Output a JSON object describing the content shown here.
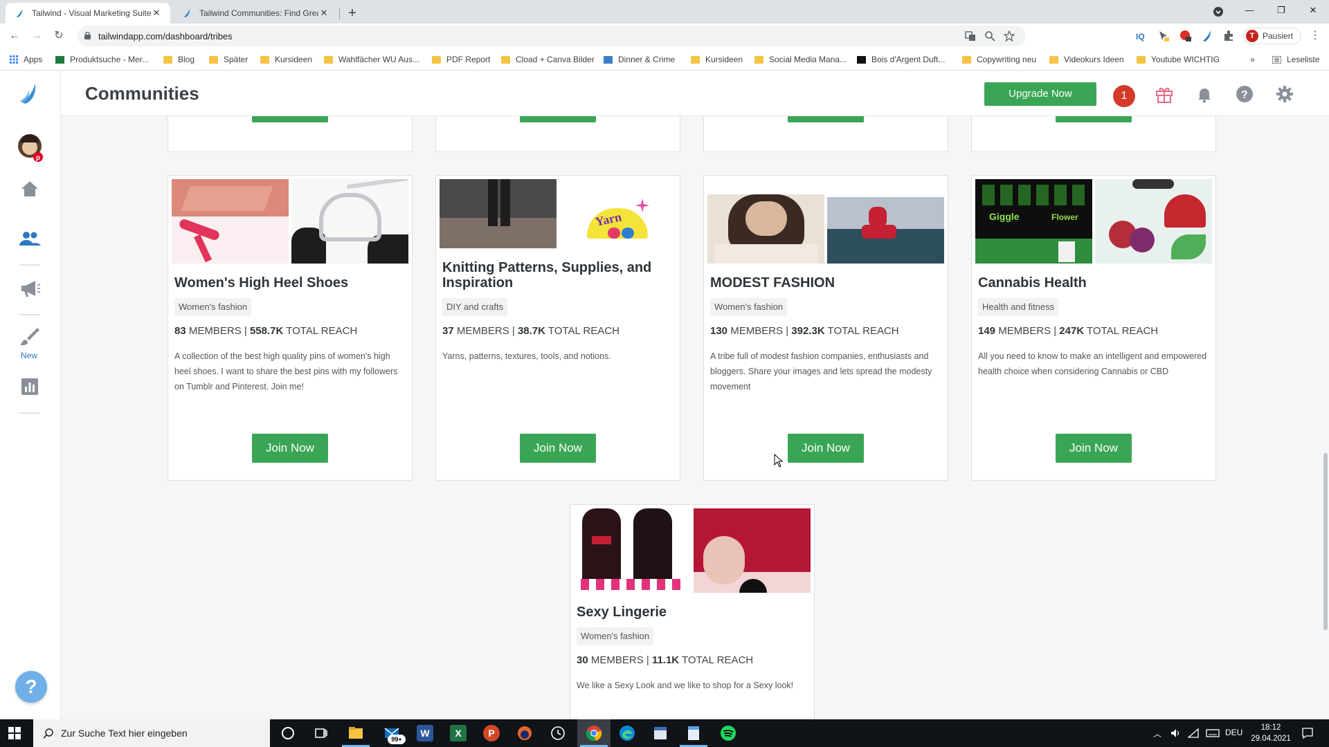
{
  "browser": {
    "tabs": [
      {
        "title": "Tailwind - Visual Marketing Suite"
      },
      {
        "title": "Tailwind Communities: Find Great"
      }
    ],
    "url": "tailwindapp.com/dashboard/tribes",
    "profile_initial": "T",
    "profile_label": "Pausiert",
    "bookmarks": [
      "Apps",
      "Produktsuche - Mer...",
      "Blog",
      "Später",
      "Kursideen",
      "Wahlfächer WU Aus...",
      "PDF Report",
      "Cload + Canva Bilder",
      "Dinner & Crime",
      "Kursideen",
      "Social Media Mana...",
      "Bois d'Argent Duft...",
      "Copywriting neu",
      "Videokurs Ideen",
      "Youtube WICHTIG"
    ],
    "reading_list": "Leseliste"
  },
  "app": {
    "page_title": "Communities",
    "upgrade_label": "Upgrade Now",
    "notification_count": "1",
    "sidebar_new_label": "New",
    "help_label": "?",
    "join_label": "Join Now"
  },
  "communities": [
    {
      "title": "Women's High Heel Shoes",
      "category": "Women's fashion",
      "members": "83",
      "members_label": " MEMBERS | ",
      "reach": "558.7K",
      "reach_label": " TOTAL REACH",
      "description": "A collection of the best high quality pins of women's high heel shoes. I want to share the best pins with my followers on Tumblr and Pinterest. Join me!"
    },
    {
      "title": "Knitting Patterns, Supplies, and Inspiration",
      "category": "DIY and crafts",
      "members": "37",
      "members_label": " MEMBERS | ",
      "reach": "38.7K",
      "reach_label": " TOTAL REACH",
      "description": "Yarns, patterns, textures, tools, and notions."
    },
    {
      "title": "MODEST FASHION",
      "category": "Women's fashion",
      "members": "130",
      "members_label": " MEMBERS | ",
      "reach": "392.3K",
      "reach_label": " TOTAL REACH",
      "description": "A tribe full of modest fashion companies, enthusiasts and bloggers. Share your images and lets spread the modesty movement"
    },
    {
      "title": "Cannabis Health",
      "category": "Health and fitness",
      "members": "149",
      "members_label": " MEMBERS | ",
      "reach": "247K",
      "reach_label": " TOTAL REACH",
      "description": "All you need to know to make an intelligent and empowered health choice when considering Cannabis or CBD"
    },
    {
      "title": "Sexy Lingerie",
      "category": "Women's fashion",
      "members": "30",
      "members_label": " MEMBERS | ",
      "reach": "11.1K",
      "reach_label": " TOTAL REACH",
      "description": "We like a Sexy Look and we like to shop for a Sexy look!"
    }
  ],
  "image_text": {
    "yarn": "Yarn",
    "cannabis_flower": "Flower",
    "cannabis_giggle": "Giggle"
  },
  "taskbar": {
    "search_placeholder": "Zur Suche Text hier eingeben",
    "mail_badge": "99+",
    "language": "DEU",
    "time": "18:12",
    "date": "29.04.2021"
  },
  "colors": {
    "accent_green": "#3aa655",
    "brand_blue": "#2b79c2",
    "badge_red": "#d23b27"
  }
}
